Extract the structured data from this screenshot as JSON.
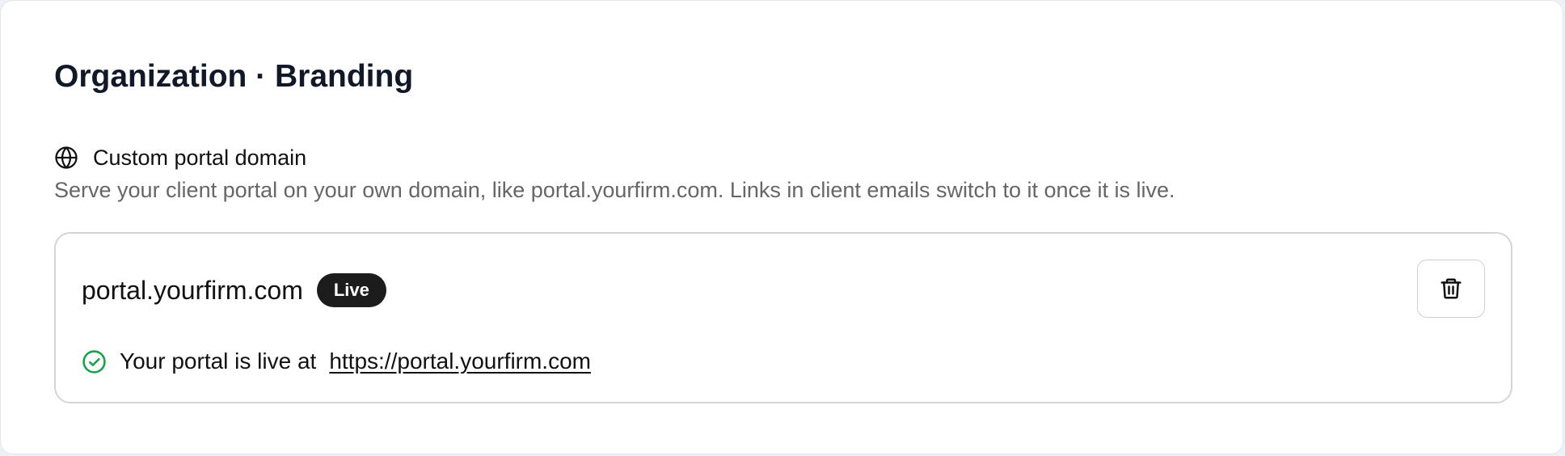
{
  "page": {
    "title": "Organization · Branding"
  },
  "section": {
    "icon": "globe-icon",
    "title": "Custom portal domain",
    "description": "Serve your client portal on your own domain, like portal.yourfirm.com. Links in client emails switch to it once it is live."
  },
  "domain": {
    "name": "portal.yourfirm.com",
    "status_badge": "Live",
    "delete_icon": "trash-icon",
    "status": {
      "icon": "check-circle-icon",
      "text": "Your portal is live at",
      "link": "https://portal.yourfirm.com"
    }
  },
  "colors": {
    "title": "#111827",
    "muted_text": "#666666",
    "badge_bg": "#1c1c1c",
    "success": "#16a34a",
    "border": "#d5d5d5"
  }
}
